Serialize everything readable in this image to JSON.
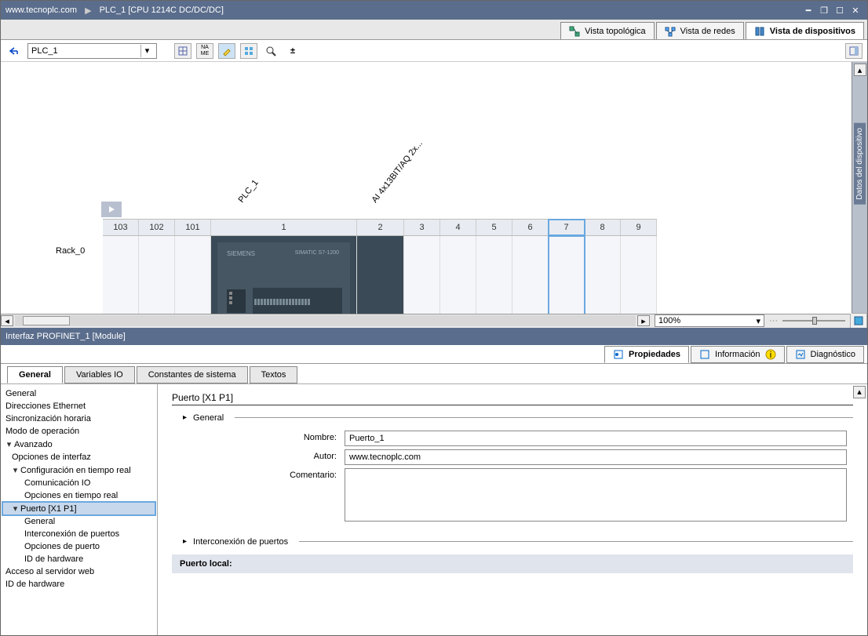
{
  "titlebar": {
    "site": "www.tecnoplc.com",
    "device": "PLC_1 [CPU 1214C DC/DC/DC]"
  },
  "views": {
    "topo": "Vista topológica",
    "net": "Vista de redes",
    "dev": "Vista de dispositivos"
  },
  "toolbar": {
    "device": "PLC_1"
  },
  "rail": {
    "label": "Datos del dispositivo"
  },
  "rack": {
    "label": "Rack_0",
    "plc_label": "PLC_1",
    "mod2_label": "AI 4x13BIT/AQ 2x...",
    "slots": [
      "103",
      "102",
      "101",
      "1",
      "2",
      "3",
      "4",
      "5",
      "6",
      "7",
      "8",
      "9"
    ],
    "cpu_brand": "SIEMENS",
    "cpu_model": "SIMATIC S7-1200"
  },
  "zoom": {
    "value": "100%"
  },
  "panel": {
    "title": "Interfaz PROFINET_1 [Module]"
  },
  "proptabs": {
    "prop": "Propiedades",
    "info": "Información",
    "diag": "Diagnóstico"
  },
  "cattabs": {
    "general": "General",
    "vario": "Variables IO",
    "const": "Constantes de sistema",
    "text": "Textos"
  },
  "tree": {
    "general": "General",
    "dir": "Direcciones Ethernet",
    "sync": "Sincronización horaria",
    "modo": "Modo de operación",
    "adv": "Avanzado",
    "opif": "Opciones de interfaz",
    "cfg": "Configuración en tiempo real",
    "comio": "Comunicación IO",
    "optr": "Opciones en tiempo real",
    "port": "Puerto [X1 P1]",
    "pgen": "General",
    "pint": "Interconexión de puertos",
    "popc": "Opciones de puerto",
    "pidh": "ID de hardware",
    "srv": "Acceso al servidor web",
    "idh": "ID de hardware"
  },
  "form": {
    "title": "Puerto [X1 P1]",
    "sect_general": "General",
    "lbl_nombre": "Nombre:",
    "val_nombre": "Puerto_1",
    "lbl_autor": "Autor:",
    "val_autor": "www.tecnoplc.com",
    "lbl_com": "Comentario:",
    "sect_inter": "Interconexión de puertos",
    "local": "Puerto local:"
  }
}
